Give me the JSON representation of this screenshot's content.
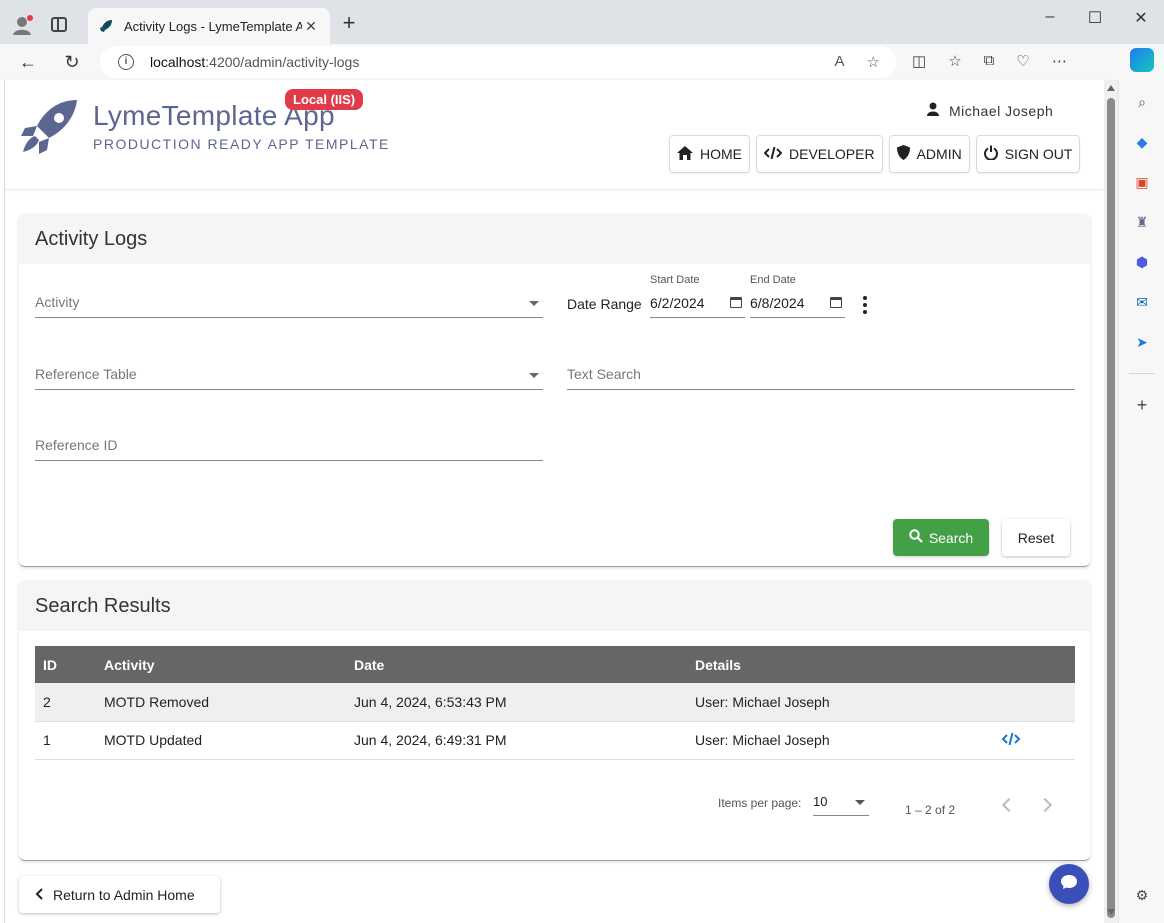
{
  "browser": {
    "tab_title": "Activity Logs - LymeTemplate App",
    "url_host": "localhost",
    "url_path": ":4200/admin/activity-logs"
  },
  "header": {
    "app_name": "LymeTemplate App",
    "tagline": "PRODUCTION READY APP TEMPLATE",
    "env_badge": "Local (IIS)",
    "user_name": "Michael Joseph",
    "nav": {
      "home": "HOME",
      "developer": "DEVELOPER",
      "admin": "ADMIN",
      "sign_out": "SIGN OUT"
    },
    "brand_color": "#5c6791"
  },
  "filters": {
    "title": "Activity Logs",
    "activity_placeholder": "Activity",
    "reference_table_placeholder": "Reference Table",
    "reference_id_placeholder": "Reference ID",
    "date_range_label": "Date Range",
    "start_date_label": "Start Date",
    "start_date_value": "6/2/2024",
    "end_date_label": "End Date",
    "end_date_value": "6/8/2024",
    "text_search_placeholder": "Text Search",
    "search_label": "Search",
    "reset_label": "Reset"
  },
  "results": {
    "title": "Search Results",
    "columns": [
      "ID",
      "Activity",
      "Date",
      "Details"
    ],
    "rows": [
      {
        "id": "2",
        "activity": "MOTD Removed",
        "date": "Jun 4, 2024, 6:53:43 PM",
        "details": "User: Michael Joseph"
      },
      {
        "id": "1",
        "activity": "MOTD Updated",
        "date": "Jun 4, 2024, 6:49:31 PM",
        "details": "User: Michael Joseph"
      }
    ],
    "items_per_page_label": "Items per page:",
    "items_per_page_value": "10",
    "range_label": "1 – 2 of 2"
  },
  "footer": {
    "return_label": "Return to Admin Home"
  },
  "colors": {
    "search_button": "#43a047",
    "env_badge": "#e03b47",
    "table_header": "#666666",
    "chat_button": "#3b4fb8"
  }
}
